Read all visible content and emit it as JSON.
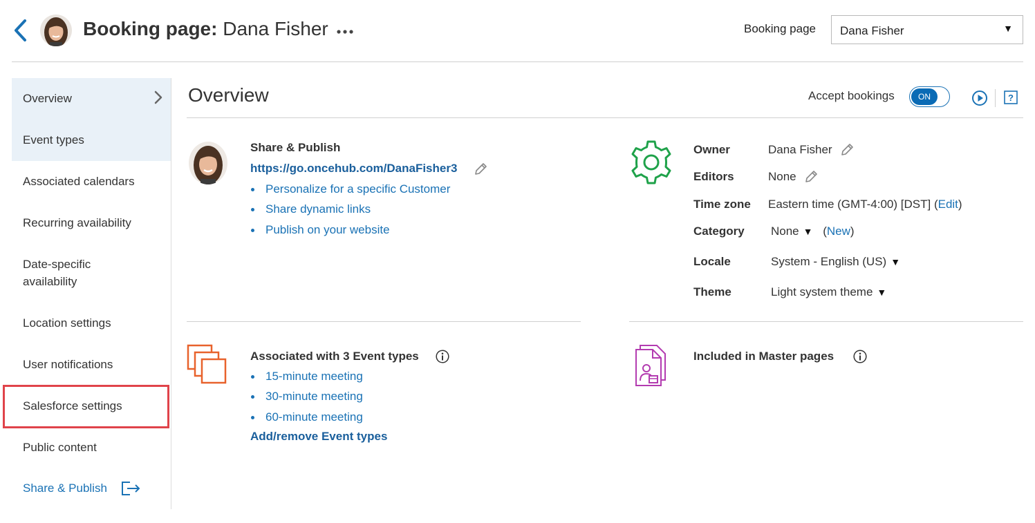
{
  "header": {
    "title_prefix": "Booking page:",
    "title_name": "Dana Fisher",
    "booking_page_label": "Booking page",
    "booking_page_selected": "Dana Fisher"
  },
  "sidebar": {
    "items": [
      {
        "label": "Overview"
      },
      {
        "label": "Event types"
      },
      {
        "label": "Associated calendars"
      },
      {
        "label": "Recurring availability"
      },
      {
        "label": "Date-specific availability"
      },
      {
        "label": "Location settings"
      },
      {
        "label": "User notifications"
      },
      {
        "label": "Salesforce settings"
      },
      {
        "label": "Public content"
      },
      {
        "label": "Share & Publish"
      }
    ]
  },
  "main": {
    "title": "Overview",
    "accept_label": "Accept bookings",
    "toggle_state": "ON",
    "share_publish": {
      "title": "Share & Publish",
      "url": "https://go.oncehub.com/DanaFisher3",
      "links": [
        "Personalize for a specific Customer",
        "Share dynamic links",
        "Publish on your website"
      ]
    },
    "properties": {
      "owner_label": "Owner",
      "owner_value": "Dana Fisher",
      "editors_label": "Editors",
      "editors_value": "None",
      "timezone_label": "Time zone",
      "timezone_value": "Eastern time (GMT-4:00) [DST] (",
      "timezone_edit": "Edit",
      "timezone_close": ")",
      "category_label": "Category",
      "category_value": "None",
      "category_new_open": "(",
      "category_new": "New",
      "category_new_close": ")",
      "locale_label": "Locale",
      "locale_value": "System - English (US)",
      "theme_label": "Theme",
      "theme_value": "Light system theme"
    },
    "event_types": {
      "title": "Associated with 3 Event types",
      "items": [
        "15-minute meeting",
        "30-minute meeting",
        "60-minute meeting"
      ],
      "add_remove": "Add/remove Event types"
    },
    "master_pages": {
      "title": "Included in Master pages"
    }
  },
  "colors": {
    "link": "#1a72b5",
    "toggle": "#0a6bb5",
    "gear": "#1fa24a",
    "event_icon": "#e8622c",
    "master_icon": "#b33bb0",
    "highlight": "#e0434a"
  }
}
